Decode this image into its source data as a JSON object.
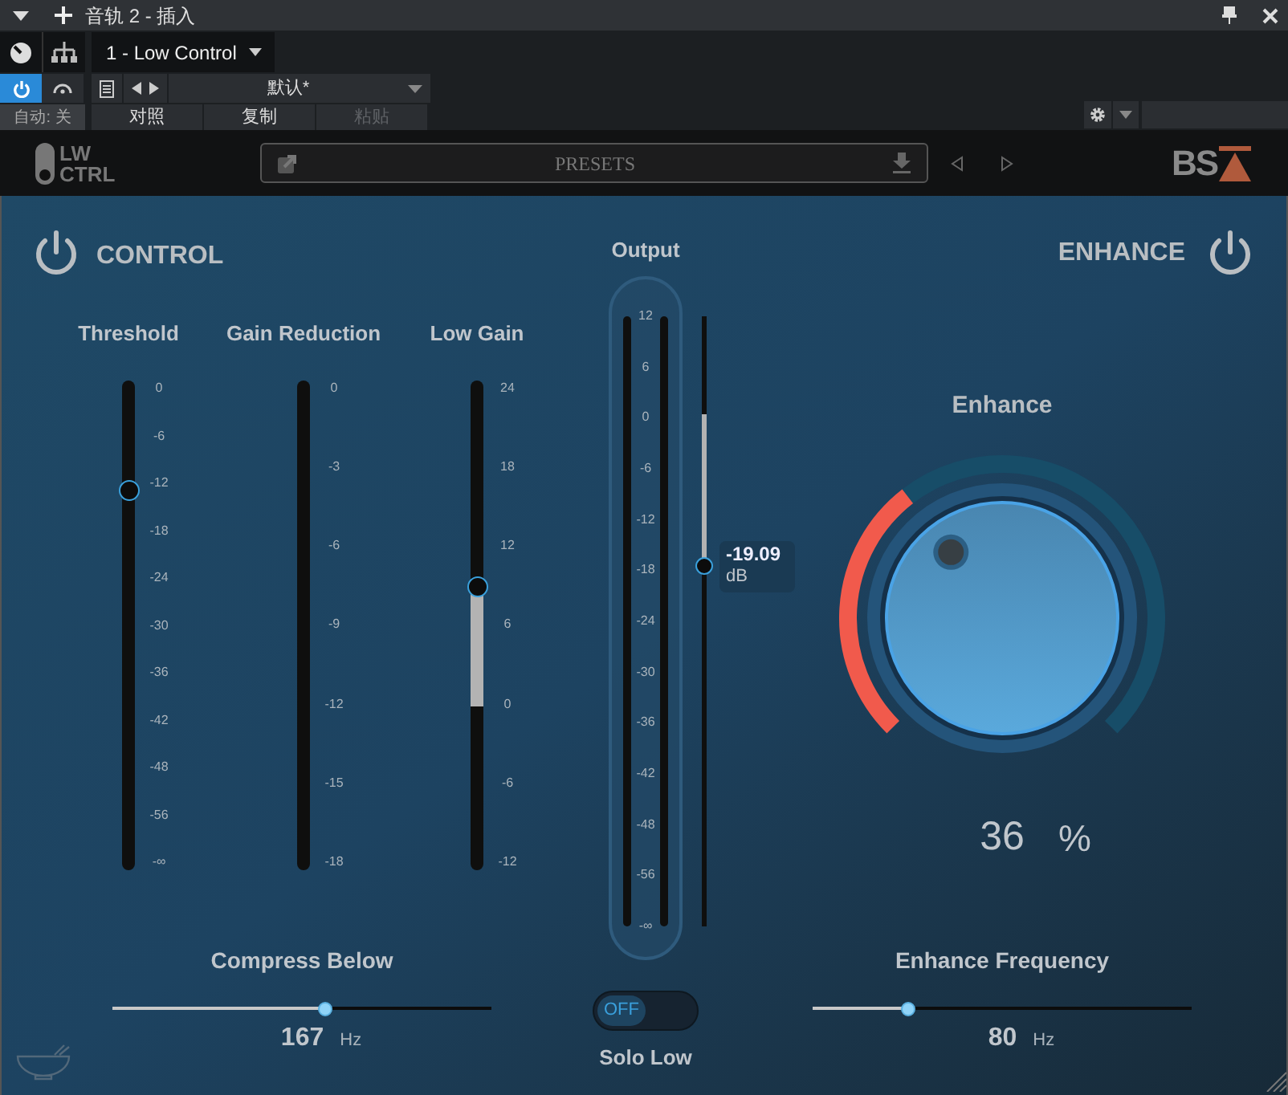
{
  "window": {
    "title": "音轨 2 - 插入"
  },
  "insert_tab": {
    "label": "1 - Low Control"
  },
  "toolbar": {
    "power_on": true,
    "preset": "默认*",
    "automation": "自动: 关",
    "actions": [
      {
        "label": "对照",
        "disabled": false
      },
      {
        "label": "复制",
        "disabled": false
      },
      {
        "label": "粘贴",
        "disabled": true
      }
    ]
  },
  "plugin_header": {
    "logo_lines": [
      "LW",
      "CTRL"
    ],
    "presets_label": "PRESETS",
    "brand": "BS"
  },
  "control": {
    "title": "CONTROL"
  },
  "channels": [
    {
      "label": "Threshold",
      "kind": "slider",
      "level": 0.774,
      "ticks": [
        "0",
        "-6",
        "-12",
        "-18",
        "-24",
        "-30",
        "-36",
        "-42",
        "-48",
        "-56",
        "-∞"
      ]
    },
    {
      "label": "Gain Reduction",
      "kind": "meter",
      "ticks": [
        "0",
        "-3",
        "-6",
        "-9",
        "-12",
        "-15",
        "-18"
      ]
    },
    {
      "label": "Low Gain",
      "kind": "bipolar",
      "level": 0.58,
      "ticks": [
        "24",
        "18",
        "12",
        "6",
        "0",
        "-6",
        "-12"
      ]
    }
  ],
  "output": {
    "label": "Output",
    "ticks": [
      "12",
      "6",
      "0",
      "-6",
      "-12",
      "-18",
      "-24",
      "-30",
      "-36",
      "-42",
      "-48",
      "-56",
      "-∞"
    ],
    "level": 0.59,
    "value": "-19.09",
    "unit": "dB"
  },
  "enhance": {
    "title": "ENHANCE",
    "knob_label": "Enhance",
    "value": "36",
    "unit": "%"
  },
  "compress_below": {
    "label": "Compress Below",
    "level": 0.56,
    "value": "167",
    "unit": "Hz"
  },
  "solo_low": {
    "label": "Solo Low",
    "on": false,
    "state_text": "OFF"
  },
  "enhance_frequency": {
    "label": "Enhance Frequency",
    "level": 0.25,
    "value": "80",
    "unit": "Hz"
  }
}
